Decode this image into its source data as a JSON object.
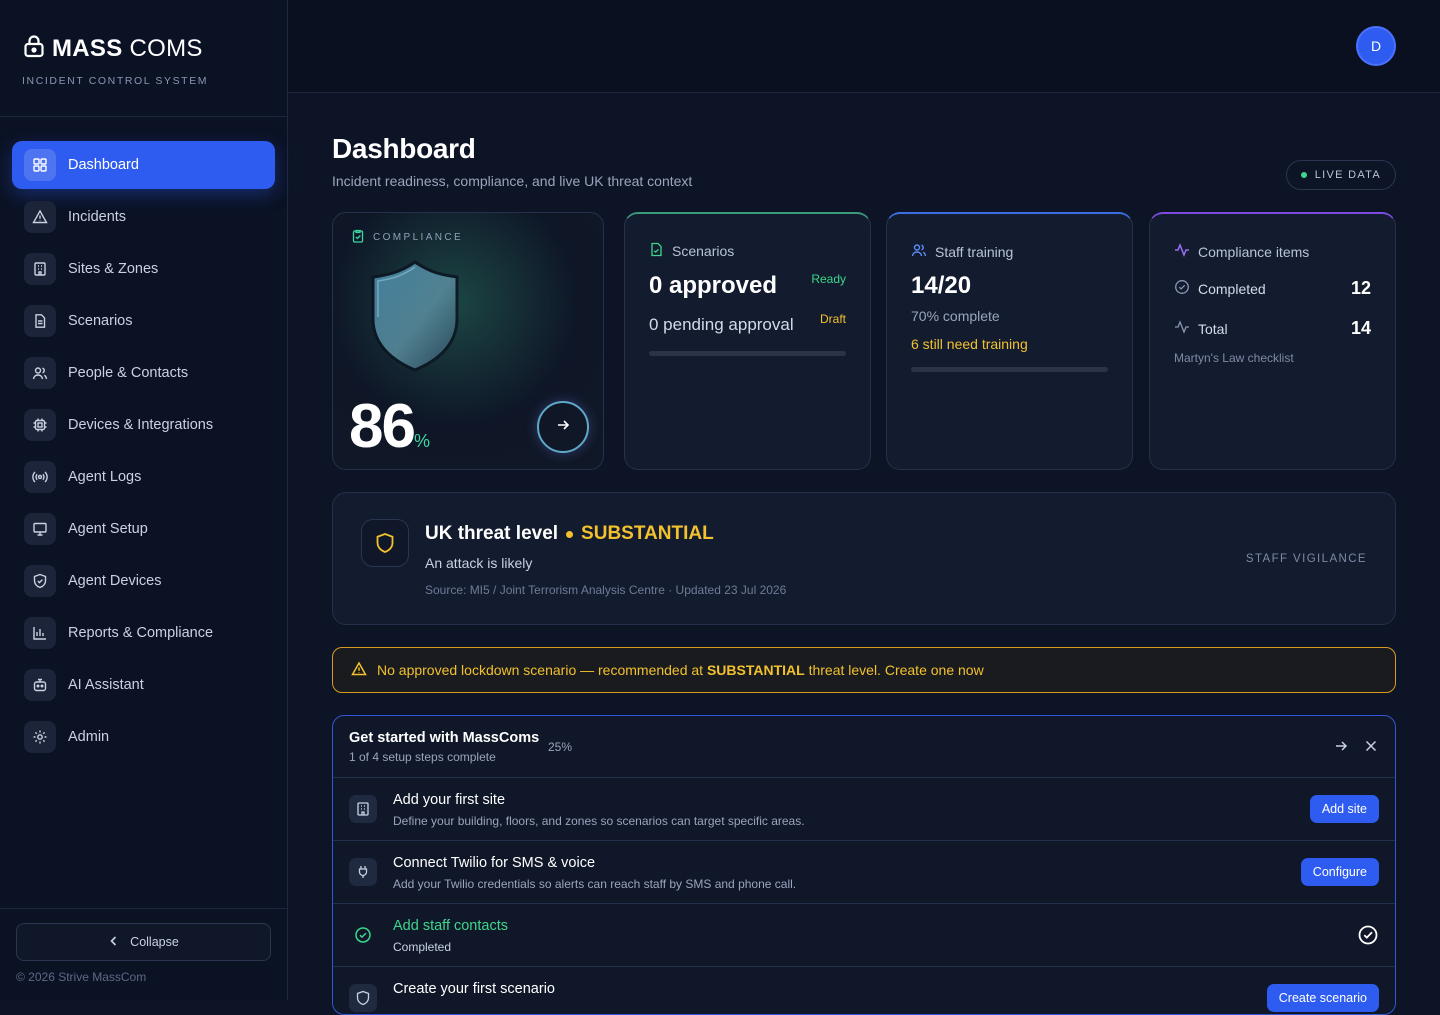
{
  "brand": {
    "name_bold": "MASS",
    "name_light": " COMS",
    "subtitle": "INCIDENT CONTROL SYSTEM"
  },
  "sidebar": {
    "items": [
      {
        "label": "Dashboard",
        "icon": "dashboard-grid-icon",
        "active": true
      },
      {
        "label": "Incidents",
        "icon": "warning-triangle-icon"
      },
      {
        "label": "Sites & Zones",
        "icon": "building-icon"
      },
      {
        "label": "Scenarios",
        "icon": "document-icon"
      },
      {
        "label": "People & Contacts",
        "icon": "people-icon"
      },
      {
        "label": "Devices & Integrations",
        "icon": "chip-icon"
      },
      {
        "label": "Agent Logs",
        "icon": "broadcast-icon"
      },
      {
        "label": "Agent Setup",
        "icon": "monitor-icon"
      },
      {
        "label": "Agent Devices",
        "icon": "shield-check-icon"
      },
      {
        "label": "Reports & Compliance",
        "icon": "bar-chart-icon"
      },
      {
        "label": "AI Assistant",
        "icon": "robot-icon"
      },
      {
        "label": "Admin",
        "icon": "gear-icon"
      }
    ],
    "collapse_label": "Collapse",
    "copyright": "© 2026 Strive MassCom"
  },
  "user": {
    "initial": "D"
  },
  "page": {
    "title": "Dashboard",
    "subtitle": "Incident readiness, compliance, and live UK threat context",
    "live_label": "LIVE DATA"
  },
  "compliance_card": {
    "label": "COMPLIANCE",
    "value": "86",
    "unit": "%"
  },
  "scenarios_card": {
    "title": "Scenarios",
    "approved": "0 approved",
    "approved_tag": "Ready",
    "pending": "0 pending approval",
    "pending_tag": "Draft",
    "progress": 0
  },
  "training_card": {
    "title": "Staff training",
    "value": "14/20",
    "complete": "70% complete",
    "need": "6 still need training",
    "progress": 0.7
  },
  "compliance_items": {
    "title": "Compliance items",
    "completed_label": "Completed",
    "completed_value": "12",
    "total_label": "Total",
    "total_value": "14",
    "footer": "Martyn's Law checklist"
  },
  "threat": {
    "title": "UK threat level",
    "level": "SUBSTANTIAL",
    "description": "An attack is likely",
    "source": "Source: MI5 / Joint Terrorism Analysis Centre · Updated 23 Jul 2026",
    "tag": "STAFF VIGILANCE"
  },
  "warning": {
    "prefix": "No approved lockdown scenario — recommended at ",
    "level": "SUBSTANTIAL",
    "suffix": " threat level. Create one now"
  },
  "setup": {
    "title": "Get started with MassComs",
    "steps_text": "1 of 4 setup steps complete",
    "percent": "25%",
    "steps": [
      {
        "title": "Add your first site",
        "desc": "Define your building, floors, and zones so scenarios can target specific areas.",
        "button": "Add site",
        "icon": "building-icon"
      },
      {
        "title": "Connect Twilio for SMS & voice",
        "desc": "Add your Twilio credentials so alerts can reach staff by SMS and phone call.",
        "button": "Configure",
        "icon": "plug-icon"
      },
      {
        "title": "Add staff contacts",
        "desc": "Completed",
        "done": true,
        "icon": "check-circle-icon"
      },
      {
        "title": "Create your first scenario",
        "desc": "",
        "button": "Create scenario",
        "icon": "shield-icon"
      }
    ]
  },
  "colors": {
    "accent": "#2f5cf0",
    "success": "#3dd68c",
    "warning": "#f2c12e",
    "violet": "#7c4ce0"
  }
}
